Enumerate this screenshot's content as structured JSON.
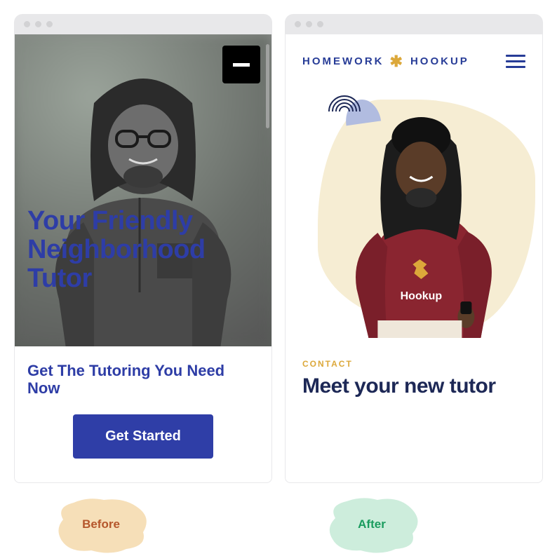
{
  "before": {
    "hero_title_line1": "Your Friendly",
    "hero_title_line2": "Neighborhood",
    "hero_title_line3": "Tutor",
    "minus_icon": "minus-icon",
    "subhead": "Get The Tutoring You Need Now",
    "cta_label": "Get Started"
  },
  "after": {
    "logo_left": "HOMEWORK",
    "logo_right": "HOOKUP",
    "tshirt_line2": "Hookup",
    "eyebrow": "CONTACT",
    "headline": "Meet your new tutor"
  },
  "labels": {
    "before": "Before",
    "after": "After"
  }
}
